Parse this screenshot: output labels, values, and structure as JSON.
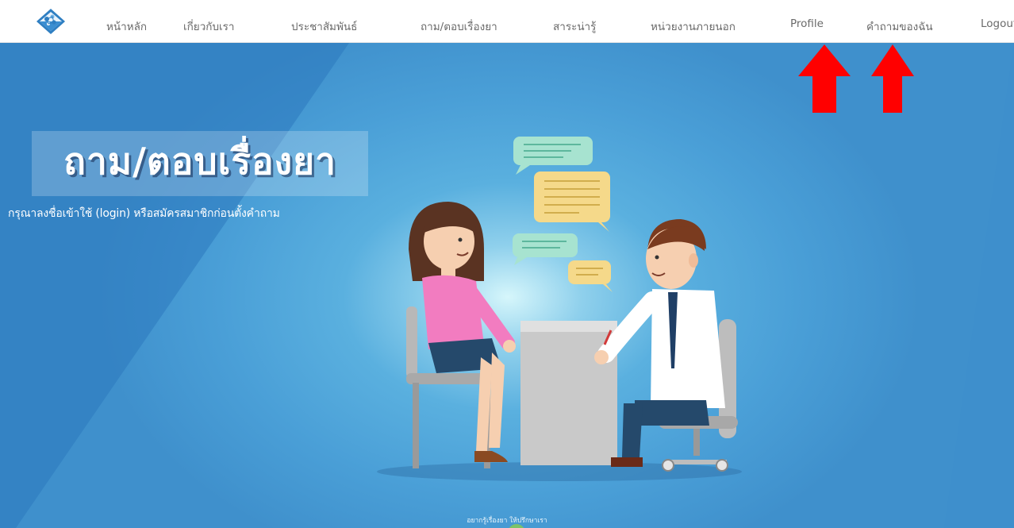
{
  "nav": {
    "items": [
      {
        "id": "home",
        "label": "หน้าหลัก"
      },
      {
        "id": "about",
        "label": "เกี่ยวกับเรา"
      },
      {
        "id": "news",
        "label": "ประชาสัมพันธ์"
      },
      {
        "id": "qa",
        "label": "ถาม/ตอบเรื่องยา"
      },
      {
        "id": "knowledge",
        "label": "สาระน่ารู้"
      },
      {
        "id": "external",
        "label": "หน่วยงานภายนอก"
      },
      {
        "id": "profile",
        "label": "Profile"
      },
      {
        "id": "my-questions",
        "label": "คำถามของฉัน"
      },
      {
        "id": "logout",
        "label": "Logout"
      }
    ]
  },
  "hero": {
    "title": "ถาม/ตอบเรื่องยา",
    "subtitle": "กรุณาลงชื่อเข้าใช้ (login) หรือสมัครสมาชิกก่อนตั้งคำถาม",
    "footer_tagline": "อยากรู้เรื่องยา ให้ปรึกษาเรา"
  },
  "annotations": {
    "arrow_color": "#ff0000"
  },
  "colors": {
    "hero_blue": "#4a9fd7",
    "nav_text": "#6a6a6a"
  }
}
